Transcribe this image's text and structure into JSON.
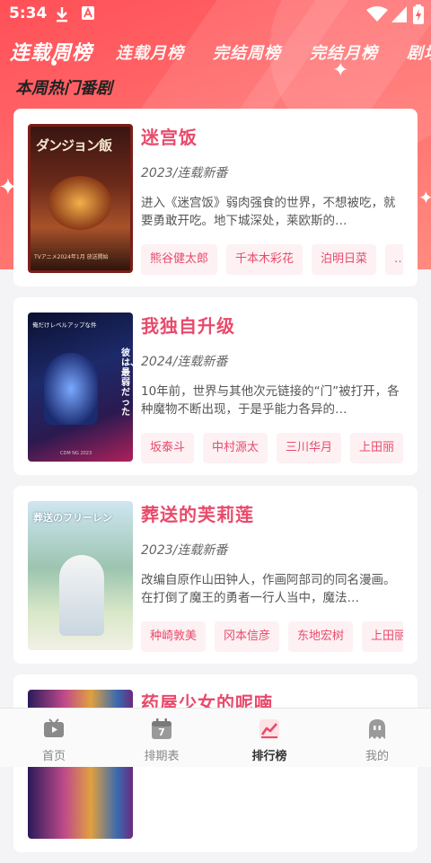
{
  "status_bar": {
    "time": "5:34"
  },
  "tabs": [
    {
      "label": "连载周榜",
      "active": true
    },
    {
      "label": "连载月榜",
      "active": false
    },
    {
      "label": "完结周榜",
      "active": false
    },
    {
      "label": "完结月榜",
      "active": false
    },
    {
      "label": "剧场",
      "active": false
    }
  ],
  "section_title": "本周热门番剧",
  "cards": [
    {
      "title": "迷宫饭",
      "meta": "2023/连载新番",
      "description": "进入《迷宫饭》弱肉强食的世界，不想被吃，就要勇敢开吃。地下城深处，莱欧斯的…",
      "tags": [
        "熊谷健太郎",
        "千本木彩花",
        "泊明日菜",
        "…"
      ],
      "poster": {
        "title_jp": "ダンジョン飯",
        "footer": "TVアニメ2024年1月 放送開始"
      }
    },
    {
      "title": "我独自升级",
      "meta": "2024/连载新番",
      "description": "10年前，世界与其他次元链接的“门”被打开，各种魔物不断出现，于是乎能力各异的…",
      "tags": [
        "坂泰斗",
        "中村源太",
        "三川华月",
        "上田丽"
      ],
      "poster": {
        "title_jp": "俺だけレベルアップな件",
        "side": "彼は、最弱だった",
        "footer": "CDM NG 2023"
      }
    },
    {
      "title": "葬送的芙莉莲",
      "meta": "2023/连载新番",
      "description": "改编自原作山田钟人，作画阿部司的同名漫画。在打倒了魔王的勇者一行人当中，魔法…",
      "tags": [
        "种崎敦美",
        "冈本信彦",
        "东地宏树",
        "上田丽"
      ],
      "poster": {
        "title_jp": "葬送のフリーレン"
      }
    },
    {
      "title": "药屋少女的呢喃",
      "meta": "",
      "description": "",
      "tags": [],
      "poster": {}
    }
  ],
  "bottom_nav": [
    {
      "label": "首页",
      "icon": "tv-icon",
      "active": false
    },
    {
      "label": "排期表",
      "icon": "calendar-icon",
      "active": false,
      "badge": "7"
    },
    {
      "label": "排行榜",
      "icon": "ranking-chart-icon",
      "active": true
    },
    {
      "label": "我的",
      "icon": "ghost-icon",
      "active": false
    }
  ],
  "colors": {
    "accent": "#e94a6b",
    "hero": "#ff5a5f",
    "tag_bg": "#fdf1f3"
  }
}
